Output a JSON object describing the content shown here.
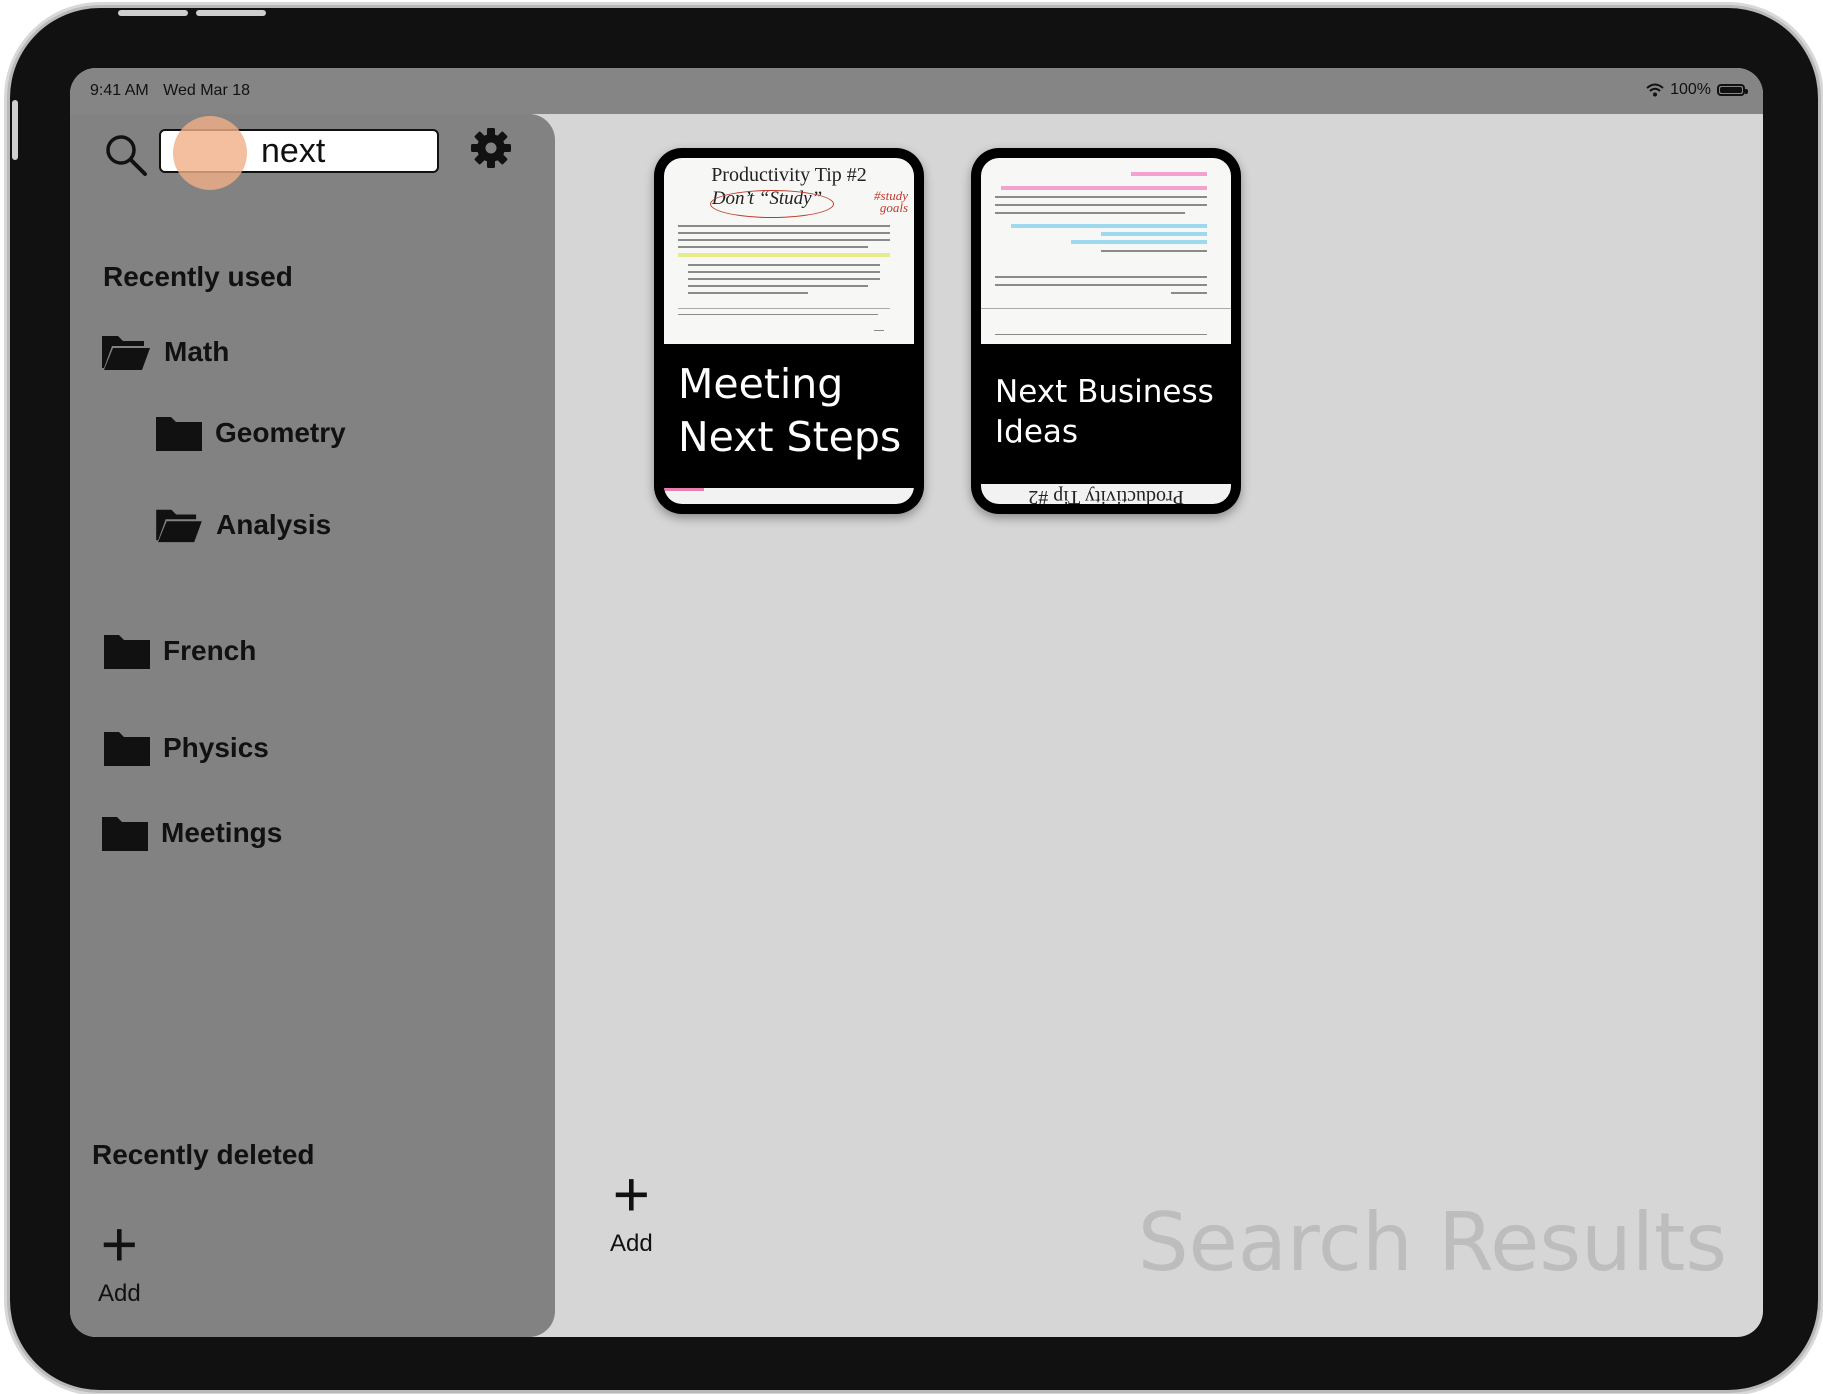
{
  "status_bar": {
    "time": "9:41 AM",
    "date": "Wed Mar 18",
    "battery": "100%"
  },
  "sidebar": {
    "search": {
      "value": "next"
    },
    "recently_used": "Recently used",
    "folders": {
      "math": "Math",
      "geometry": "Geometry",
      "analysis": "Analysis",
      "french": "French",
      "physics": "Physics",
      "meetings": "Meetings"
    },
    "recently_deleted": "Recently deleted",
    "add_label": "Add"
  },
  "main": {
    "cards": [
      {
        "title_line1": "Meeting",
        "title_line2": "Next Steps",
        "thumb_title": "Productivity Tip #2",
        "thumb_subtitle": "Don’t “Study”",
        "thumb_note": "#study goals"
      },
      {
        "title_line1": "Next Business",
        "title_line2": "Ideas",
        "strip_text": "Productivity Tip #2"
      }
    ],
    "add_label": "Add",
    "watermark": "Search Results"
  },
  "colors": {
    "sidebar_bg": "#828282",
    "content_bg": "#d6d6d6",
    "status_bar_bg": "#858585",
    "touch_indicator": "#f0af87"
  }
}
